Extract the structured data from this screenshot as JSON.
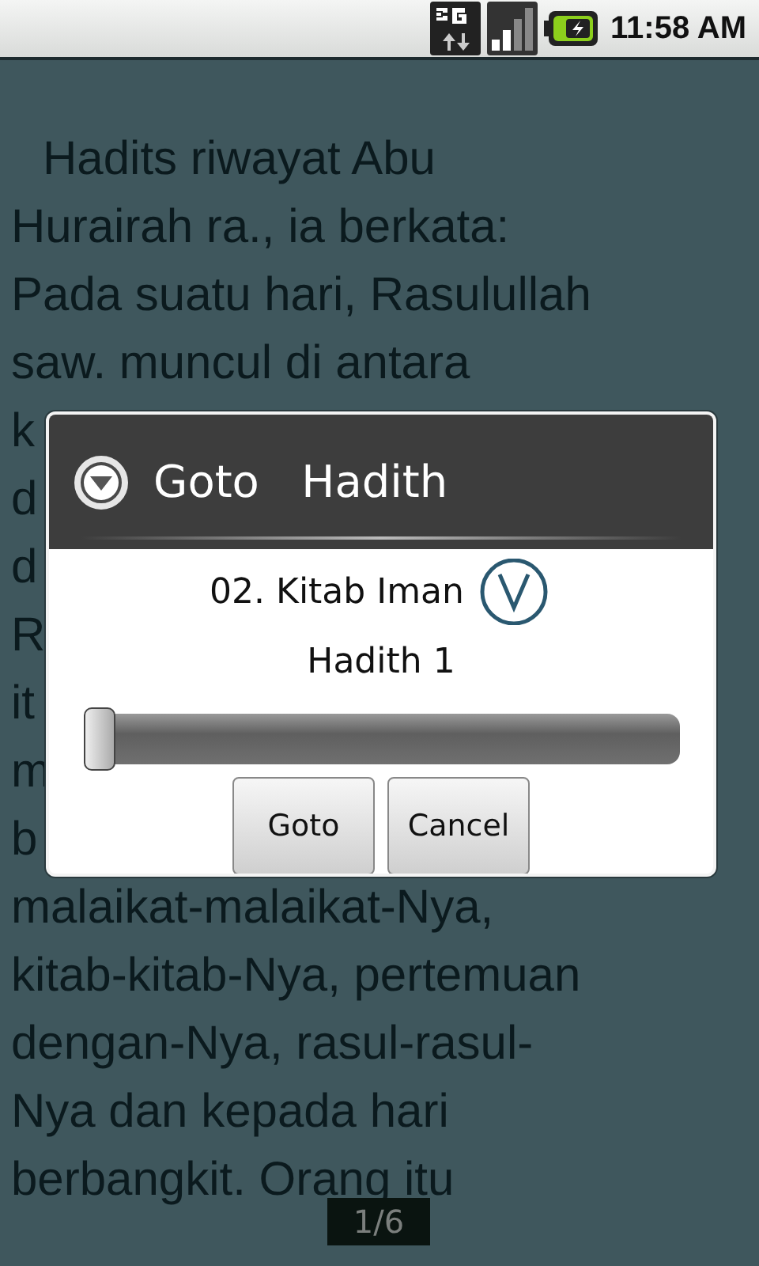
{
  "status_bar": {
    "time": "11:58 AM"
  },
  "reader": {
    "lines": [
      "Hadits riwayat Abu",
      "Hurairah ra., ia berkata:",
      "Pada suatu hari, Rasulullah",
      "saw. muncul di antara",
      "k",
      "d",
      "d",
      "R",
      "it",
      "m",
      "b",
      "malaikat-malaikat-Nya,",
      "kitab-kitab-Nya, pertemuan",
      "dengan-Nya, rasul-rasul-",
      "Nya dan kepada hari",
      "berbangkit. Orang itu"
    ],
    "page_indicator": "1/6"
  },
  "dialog": {
    "title": "Goto   Hadith",
    "kitab": "02. Kitab Iman",
    "hadith_label": "Hadith 1",
    "slider": {
      "level": 0
    },
    "buttons": [
      {
        "label": "Goto"
      },
      {
        "label": "Cancel"
      }
    ]
  }
}
